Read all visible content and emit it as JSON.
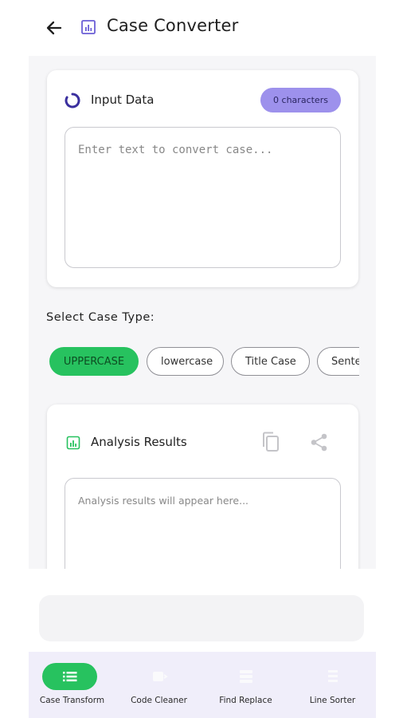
{
  "header": {
    "title": "Case Converter",
    "back_icon": "arrow-left-icon",
    "app_icon": "chart-box-icon"
  },
  "input_card": {
    "title": "Input Data",
    "char_badge": "0 characters",
    "placeholder": "Enter text to convert case...",
    "icon": "ring-icon"
  },
  "case_section": {
    "label": "Select Case Type:",
    "chips": [
      {
        "label": "UPPERCASE",
        "active": true
      },
      {
        "label": "lowercase",
        "active": false
      },
      {
        "label": "Title Case",
        "active": false
      },
      {
        "label": "Sentence case",
        "active": false
      }
    ]
  },
  "results_card": {
    "title": "Analysis Results",
    "placeholder": "Analysis results will appear here...",
    "icons": [
      "chart-icon",
      "copy-icon",
      "share-icon"
    ]
  },
  "bottom_nav": {
    "items": [
      {
        "label": "Case Transform",
        "icon": "list-icon",
        "active": true
      },
      {
        "label": "Code Cleaner",
        "icon": "code-icon",
        "active": false
      },
      {
        "label": "Find Replace",
        "icon": "replace-icon",
        "active": false
      },
      {
        "label": "Line Sorter",
        "icon": "sort-icon",
        "active": false
      }
    ]
  },
  "colors": {
    "accent_green": "#27c25f",
    "badge_purple": "#9d91ec",
    "nav_background": "#f0eefa",
    "content_background": "#f6f6f8"
  }
}
